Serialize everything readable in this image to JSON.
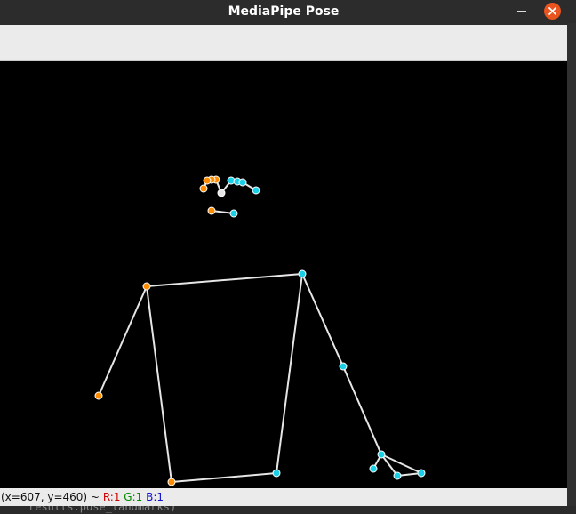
{
  "window": {
    "title": "MediaPipe Pose"
  },
  "status": {
    "coords": "(x=607, y=460) ~",
    "r": "R:1",
    "g": "G:1",
    "b": "B:1"
  },
  "background_text": "results.pose_landmarks)",
  "colors": {
    "left_landmark": "#ff8c00",
    "right_landmark": "#1ad0e8",
    "center_landmark": "#e6e6e6",
    "connection": "#e6e6e6",
    "close_button": "#e9541f"
  },
  "pose": {
    "landmarks": [
      {
        "id": 0,
        "side": "center"
      },
      {
        "id": 1,
        "side": "right"
      },
      {
        "id": 2,
        "side": "right"
      },
      {
        "id": 3,
        "side": "right"
      },
      {
        "id": 4,
        "side": "left"
      },
      {
        "id": 5,
        "side": "left"
      },
      {
        "id": 6,
        "side": "left"
      },
      {
        "id": 7,
        "side": "right"
      },
      {
        "id": 8,
        "side": "left"
      },
      {
        "id": 9,
        "side": "right"
      },
      {
        "id": 10,
        "side": "left"
      },
      {
        "id": 11,
        "side": "right"
      },
      {
        "id": 12,
        "side": "left"
      },
      {
        "id": 13,
        "side": "right"
      },
      {
        "id": 14,
        "side": "left"
      },
      {
        "id": 15,
        "side": "right"
      },
      {
        "id": 17,
        "side": "right"
      },
      {
        "id": 19,
        "side": "right"
      },
      {
        "id": 21,
        "side": "right"
      },
      {
        "id": 23,
        "side": "right"
      },
      {
        "id": 24,
        "side": "left"
      }
    ],
    "connections": [
      [
        0,
        1
      ],
      [
        1,
        2
      ],
      [
        2,
        3
      ],
      [
        3,
        7
      ],
      [
        0,
        4
      ],
      [
        4,
        5
      ],
      [
        5,
        6
      ],
      [
        6,
        8
      ],
      [
        9,
        10
      ],
      [
        11,
        12
      ],
      [
        11,
        13
      ],
      [
        13,
        15
      ],
      [
        15,
        17
      ],
      [
        15,
        19
      ],
      [
        17,
        19
      ],
      [
        15,
        21
      ],
      [
        12,
        14
      ],
      [
        11,
        23
      ],
      [
        12,
        24
      ],
      [
        23,
        24
      ]
    ]
  }
}
